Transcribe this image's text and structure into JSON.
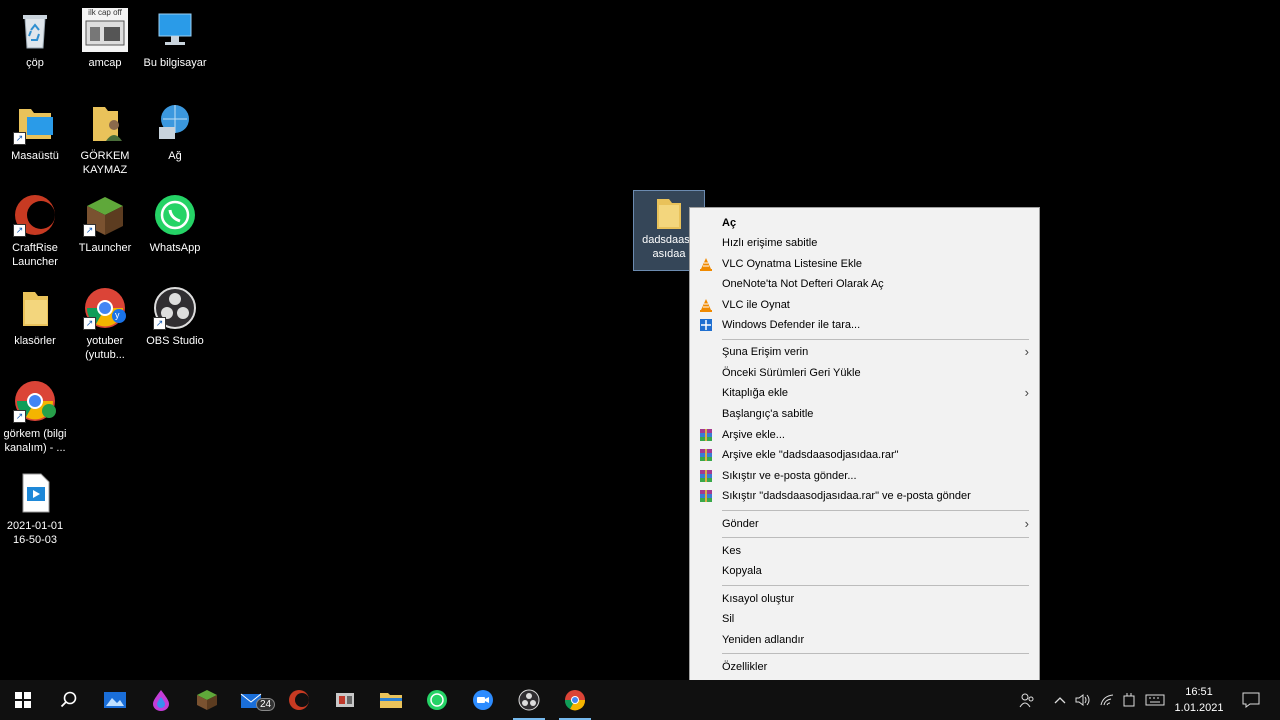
{
  "desktop": {
    "icons": [
      {
        "label": "çöp"
      },
      {
        "label": "amcap"
      },
      {
        "label": "Bu bilgisayar"
      },
      {
        "label": "Masaüstü"
      },
      {
        "label": "GÖRKEM KAYMAZ"
      },
      {
        "label": "Ağ"
      },
      {
        "label": "CraftRise Launcher"
      },
      {
        "label": "TLauncher"
      },
      {
        "label": "WhatsApp"
      },
      {
        "label": "klasörler"
      },
      {
        "label": "yotuber (yutub..."
      },
      {
        "label": "OBS Studio"
      },
      {
        "label": "görkem (bilgi kanalım) - ..."
      },
      {
        "label": "2021-01-01 16-50-03"
      }
    ],
    "amcap_thumb_text": "ilk cap off",
    "chrome_badge_1": "y",
    "chrome_badge_2": "g",
    "selected_file": {
      "label": "dadsdaaso asıdaa"
    }
  },
  "context_menu": {
    "items": [
      {
        "label": "Aç"
      },
      {
        "label": "Hızlı erişime sabitle"
      },
      {
        "label": "VLC Oynatma Listesine Ekle",
        "icon": "vlc-cone-icon"
      },
      {
        "label": "OneNote'ta Not Defteri Olarak Aç"
      },
      {
        "label": "VLC ile Oynat",
        "icon": "vlc-cone-icon"
      },
      {
        "label": "Windows Defender ile tara...",
        "icon": "defender-shield-icon"
      },
      {
        "label": "Şuna Erişim verin",
        "submenu": true
      },
      {
        "label": "Önceki Sürümleri Geri Yükle"
      },
      {
        "label": "Kitaplığa ekle",
        "submenu": true
      },
      {
        "label": "Başlangıç'a sabitle"
      },
      {
        "label": "Arşive ekle...",
        "icon": "winrar-icon"
      },
      {
        "label": "Arşive ekle \"dadsdaasodjasıdaa.rar\"",
        "icon": "winrar-icon"
      },
      {
        "label": "Sıkıştır ve e-posta gönder...",
        "icon": "winrar-icon"
      },
      {
        "label": "Sıkıştır \"dadsdaasodjasıdaa.rar\" ve e-posta gönder",
        "icon": "winrar-icon"
      },
      {
        "label": "Gönder",
        "submenu": true
      },
      {
        "label": "Kes"
      },
      {
        "label": "Kopyala"
      },
      {
        "label": "Kısayol oluştur"
      },
      {
        "label": "Sil"
      },
      {
        "label": "Yeniden adlandır"
      },
      {
        "label": "Özellikler"
      }
    ],
    "submenu_arrow": "›"
  },
  "taskbar": {
    "mail_badge": "24",
    "time": "16:51",
    "date": "1.01.2021",
    "colors": {
      "accent": "#76b9ed",
      "background": "#101010"
    }
  }
}
